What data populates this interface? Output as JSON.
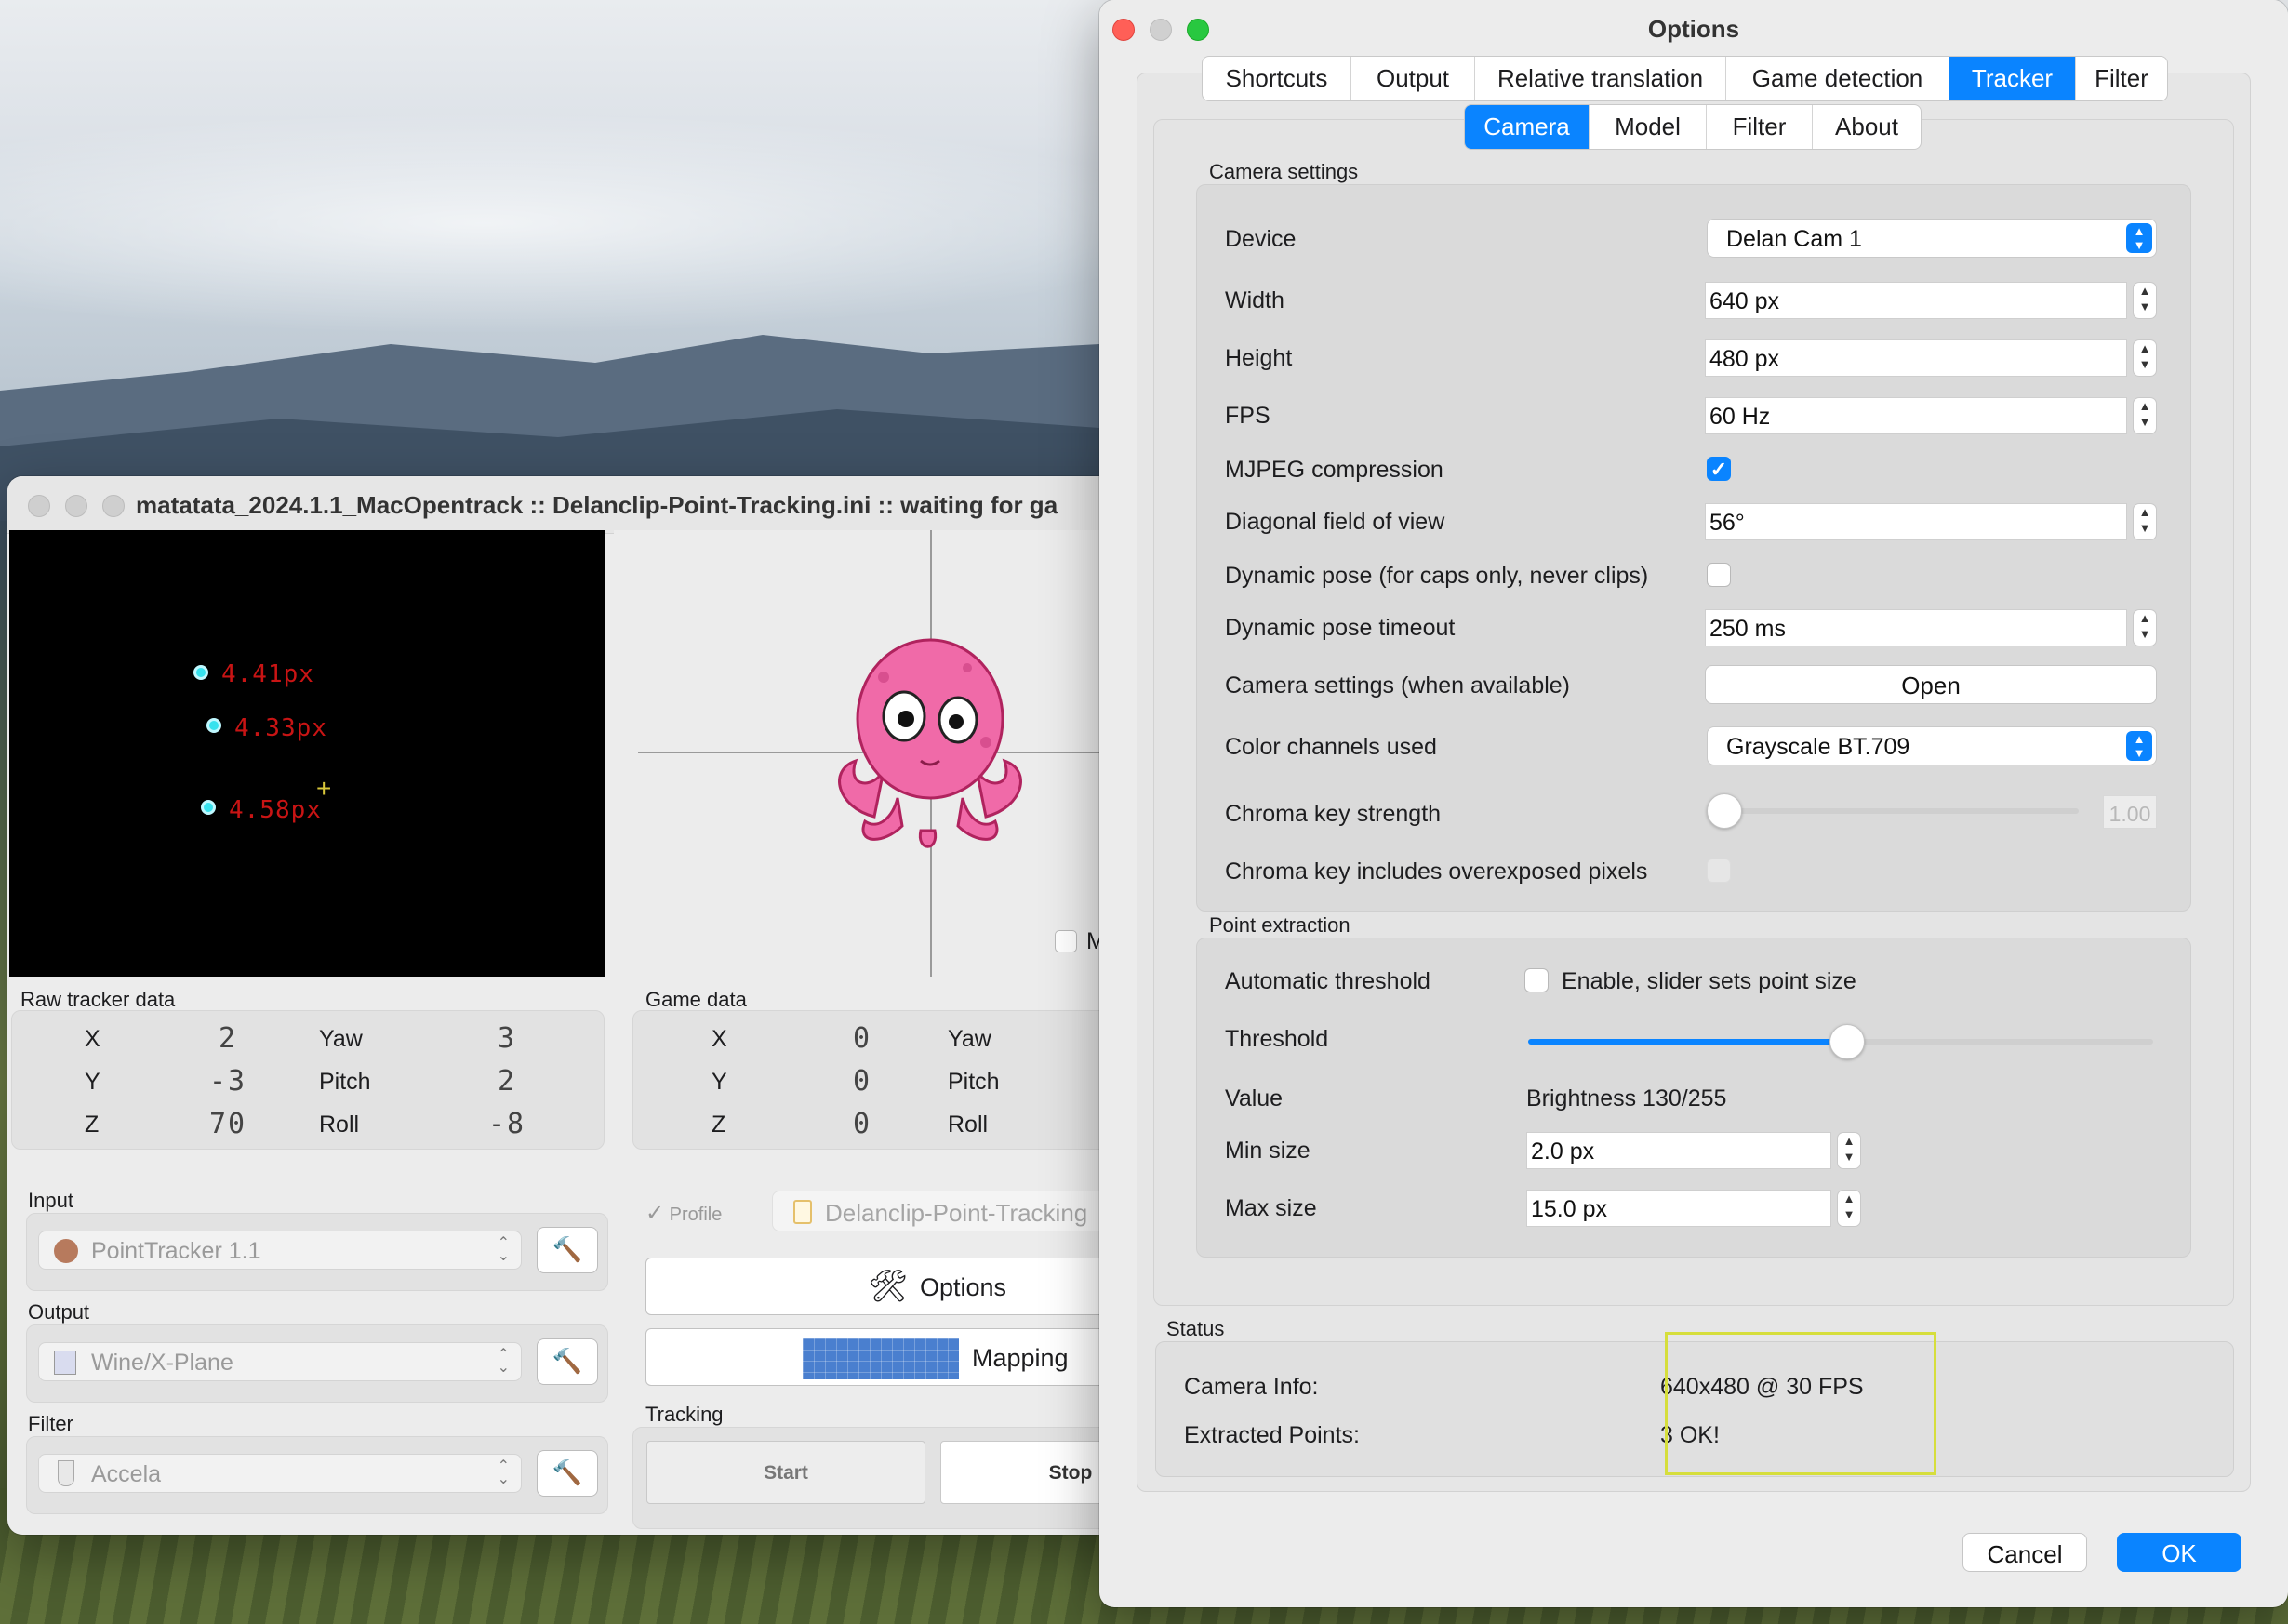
{
  "main_window": {
    "title": "matatata_2024.1.1_MacOpentrack :: Delanclip-Point-Tracking.ini :: waiting for ga",
    "points": [
      {
        "label": "4.41px"
      },
      {
        "label": "4.33px"
      },
      {
        "label": "4.58px"
      }
    ],
    "crosshair_glyph": "+",
    "mirror_checkbox_label": "M",
    "raw_tracker": {
      "title": "Raw tracker data",
      "rows": [
        {
          "axis": "X",
          "axis_value": "2",
          "rot": "Yaw",
          "rot_value": "3"
        },
        {
          "axis": "Y",
          "axis_value": "-3",
          "rot": "Pitch",
          "rot_value": "2"
        },
        {
          "axis": "Z",
          "axis_value": "70",
          "rot": "Roll",
          "rot_value": "-8"
        }
      ]
    },
    "game_data": {
      "title": "Game data",
      "rows": [
        {
          "axis": "X",
          "axis_value": "0",
          "rot": "Yaw"
        },
        {
          "axis": "Y",
          "axis_value": "0",
          "rot": "Pitch"
        },
        {
          "axis": "Z",
          "axis_value": "0",
          "rot": "Roll"
        }
      ]
    },
    "input": {
      "label": "Input",
      "value": "PointTracker 1.1",
      "icon": "tracker-icon"
    },
    "output": {
      "label": "Output",
      "value": "Wine/X-Plane",
      "icon": "xplane-icon"
    },
    "filter": {
      "label": "Filter",
      "value": "Accela",
      "icon": "filter-icon"
    },
    "profile": {
      "label": "Profile",
      "value": "Delanclip-Point-Tracking"
    },
    "options_button": "Options",
    "mapping_button": "Mapping",
    "tracking": {
      "label": "Tracking",
      "start": "Start",
      "stop": "Stop"
    }
  },
  "options_window": {
    "title": "Options",
    "tabs": [
      "Shortcuts",
      "Output",
      "Relative translation",
      "Game detection",
      "Tracker",
      "Filter"
    ],
    "active_tab": "Tracker",
    "subtabs": [
      "Camera",
      "Model",
      "Filter",
      "About"
    ],
    "active_subtab": "Camera",
    "camera_settings": {
      "title": "Camera settings",
      "device_label": "Device",
      "device_value": "Delan Cam 1",
      "width_label": "Width",
      "width_value": "640 px",
      "height_label": "Height",
      "height_value": "480 px",
      "fps_label": "FPS",
      "fps_value": "60 Hz",
      "mjpeg_label": "MJPEG compression",
      "mjpeg_checked": true,
      "fov_label": "Diagonal field of view",
      "fov_value": "56°",
      "dynpose_label": "Dynamic pose (for caps only, never clips)",
      "dynpose_checked": false,
      "dyntimeout_label": "Dynamic pose timeout",
      "dyntimeout_value": "250 ms",
      "camsettings_label": "Camera settings (when available)",
      "open_button": "Open",
      "channels_label": "Color channels used",
      "channels_value": "Grayscale BT.709",
      "chroma_label": "Chroma key strength",
      "chroma_value": "1.00",
      "chroma_level": 0.05,
      "overexposed_label": "Chroma key includes overexposed pixels"
    },
    "point_extraction": {
      "title": "Point extraction",
      "auto_label": "Automatic threshold",
      "auto_checkbox_label": "Enable, slider sets point size",
      "threshold_label": "Threshold",
      "threshold_level": 0.51,
      "value_label": "Value",
      "value_text": "Brightness 130/255",
      "min_label": "Min size",
      "min_value": "2.0 px",
      "max_label": "Max size",
      "max_value": "15.0 px"
    },
    "status": {
      "title": "Status",
      "camera_info_label": "Camera Info:",
      "camera_info_value": "640x480 @ 30 FPS",
      "points_label": "Extracted Points:",
      "points_value": "3 OK!"
    },
    "cancel_button": "Cancel",
    "ok_button": "OK"
  },
  "colors": {
    "accent": "#0a84ff",
    "highlight_box": "#d6de3c",
    "point_label": "#c81414",
    "point_dot": "#36e2ee"
  }
}
